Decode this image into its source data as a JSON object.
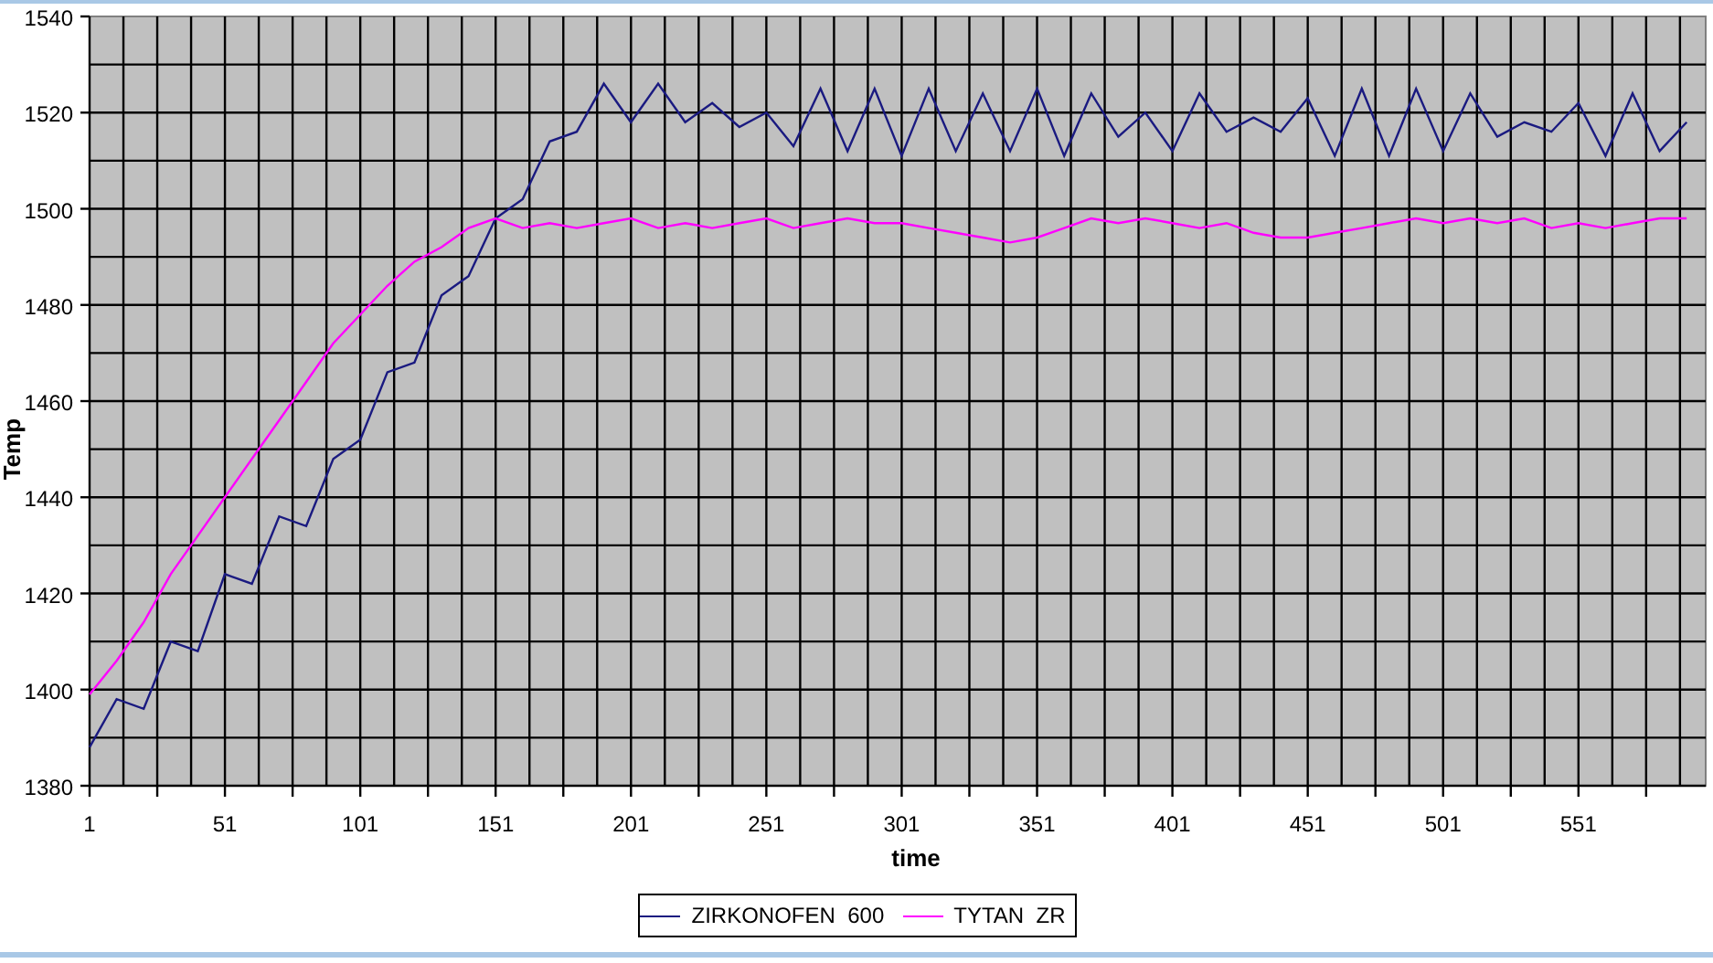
{
  "chart": {
    "chart_data": {
      "type": "line",
      "grid": true,
      "xlabel": "time",
      "ylabel": "Temp",
      "xlim": [
        1,
        598
      ],
      "ylim": [
        1380,
        1540
      ],
      "xticks": [
        1,
        51,
        101,
        151,
        201,
        251,
        301,
        351,
        401,
        451,
        501,
        551
      ],
      "yticks": [
        1380,
        1400,
        1420,
        1440,
        1460,
        1480,
        1500,
        1520,
        1540
      ],
      "x": [
        1,
        11,
        21,
        31,
        41,
        51,
        61,
        71,
        81,
        91,
        101,
        111,
        121,
        131,
        141,
        151,
        161,
        171,
        181,
        191,
        201,
        211,
        221,
        231,
        241,
        251,
        261,
        271,
        281,
        291,
        301,
        311,
        321,
        331,
        341,
        351,
        361,
        371,
        381,
        391,
        401,
        411,
        421,
        431,
        441,
        451,
        461,
        471,
        481,
        491,
        501,
        511,
        521,
        531,
        541,
        551,
        561,
        571,
        581,
        591
      ],
      "series": [
        {
          "name": "ZIRKONOFEN  600",
          "color": "#1a1a80",
          "values": [
            1388,
            1398,
            1396,
            1410,
            1408,
            1424,
            1422,
            1436,
            1434,
            1448,
            1452,
            1466,
            1468,
            1482,
            1486,
            1498,
            1502,
            1514,
            1516,
            1526,
            1518,
            1526,
            1518,
            1522,
            1517,
            1520,
            1513,
            1525,
            1512,
            1525,
            1511,
            1525,
            1512,
            1524,
            1512,
            1525,
            1511,
            1524,
            1515,
            1520,
            1512,
            1524,
            1516,
            1519,
            1516,
            1523,
            1511,
            1525,
            1511,
            1525,
            1512,
            1524,
            1515,
            1518,
            1516,
            1522,
            1511,
            1524,
            1512,
            1518
          ]
        },
        {
          "name": "TYTAN  ZR",
          "color": "#ff00ff",
          "values": [
            1399,
            1406,
            1414,
            1424,
            1432,
            1440,
            1448,
            1456,
            1464,
            1472,
            1478,
            1484,
            1489,
            1492,
            1496,
            1498,
            1496,
            1497,
            1496,
            1497,
            1498,
            1496,
            1497,
            1496,
            1497,
            1498,
            1496,
            1497,
            1498,
            1497,
            1497,
            1496,
            1495,
            1494,
            1493,
            1494,
            1496,
            1498,
            1497,
            1498,
            1497,
            1496,
            1497,
            1495,
            1494,
            1494,
            1495,
            1496,
            1497,
            1498,
            1497,
            1498,
            1497,
            1498,
            1496,
            1497,
            1496,
            1497,
            1498,
            1498
          ]
        }
      ]
    }
  }
}
